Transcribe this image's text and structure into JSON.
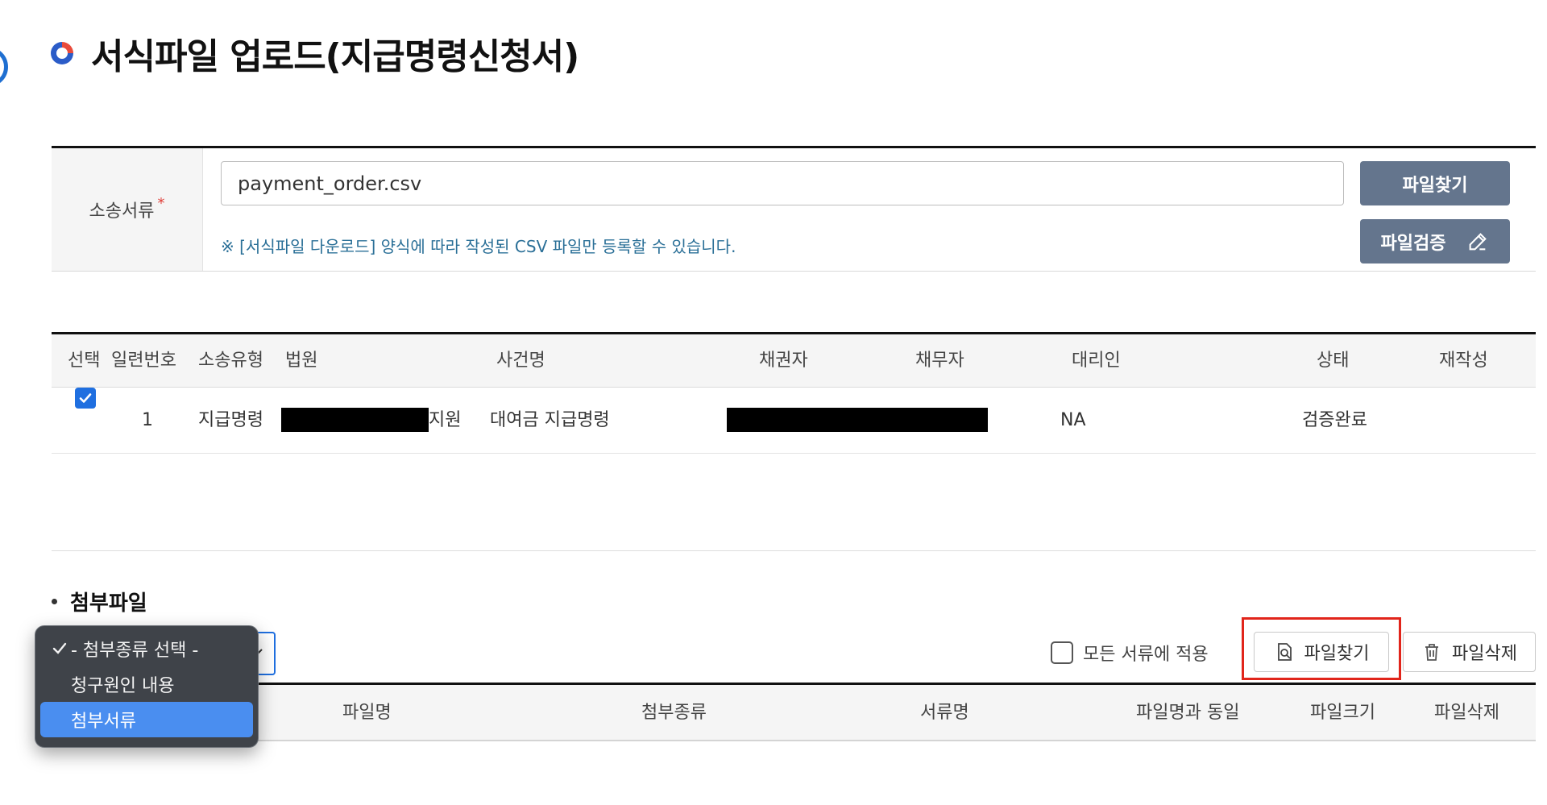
{
  "page": {
    "title": "서식파일 업로드(지급명령신청서)"
  },
  "upload_form": {
    "label": "소송서류",
    "required_mark": "*",
    "file_value": "payment_order.csv",
    "notice": "※ [서식파일 다운로드] 양식에 따라 작성된 CSV 파일만 등록할 수 있습니다.",
    "find_button": "파일찾기",
    "verify_button": "파일검증"
  },
  "suit_table": {
    "headers": [
      "선택",
      "일련번호",
      "소송유형",
      "법원",
      "사건명",
      "채권자",
      "채무자",
      "대리인",
      "상태",
      "재작성"
    ],
    "rows": [
      {
        "checked": true,
        "serial": "1",
        "type": "지급명령",
        "court_suffix": "지원",
        "case_name": "대여금 지급명령",
        "agent": "NA",
        "status": "검증완료"
      }
    ]
  },
  "attachments": {
    "section_title": "첨부파일",
    "apply_all_label": "모든 서류에 적용",
    "find_button": "파일찾기",
    "delete_button": "파일삭제",
    "headers": [
      "파일명",
      "첨부종류",
      "서류명",
      "파일명과 동일",
      "파일크기",
      "파일삭제"
    ],
    "dropdown": {
      "options": [
        {
          "label": "- 첨부종류 선택 -",
          "selected": true
        },
        {
          "label": "청구원인 내용",
          "selected": false
        },
        {
          "label": "첨부서류",
          "selected": false
        }
      ]
    }
  },
  "colors": {
    "accent_blue": "#1f6fe0",
    "button_dark": "#64758d",
    "highlight_red": "#e1251b",
    "notice_teal": "#2a6f97"
  }
}
